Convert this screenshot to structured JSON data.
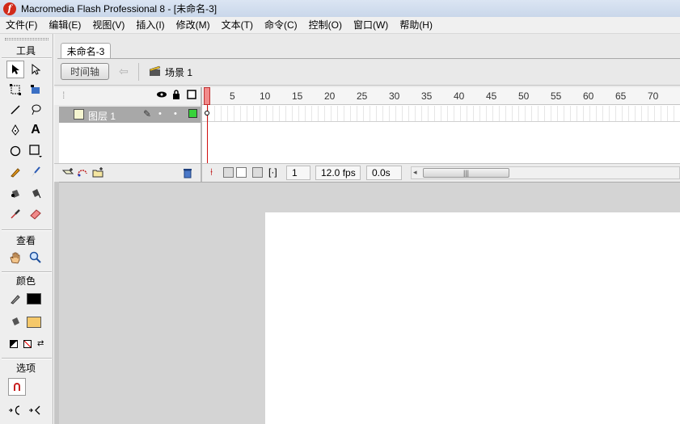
{
  "window": {
    "title": "Macromedia Flash Professional 8 - [未命名-3]",
    "app_icon": "flash-app-icon"
  },
  "menu": [
    "文件(F)",
    "编辑(E)",
    "视图(V)",
    "插入(I)",
    "修改(M)",
    "文本(T)",
    "命令(C)",
    "控制(O)",
    "窗口(W)",
    "帮助(H)"
  ],
  "tools": {
    "title": "工具",
    "view_title": "查看",
    "colors_title": "颜色",
    "options_title": "选项",
    "stroke_color": "#000000",
    "fill_color": "#f5c86a"
  },
  "document": {
    "tab_label": "未命名-3"
  },
  "timeline": {
    "toggle_label": "时间轴",
    "scene_label": "场景 1",
    "layer_name": "图层 1",
    "layer_color": "#38d23a",
    "ruler": [
      "1",
      "5",
      "10",
      "15",
      "20",
      "25",
      "30",
      "35",
      "40",
      "45",
      "50",
      "55",
      "60",
      "65",
      "70"
    ],
    "current_frame": "1",
    "frame_rate": "12.0 fps",
    "elapsed": "0.0s"
  },
  "stage": {
    "background": "#ffffff"
  }
}
